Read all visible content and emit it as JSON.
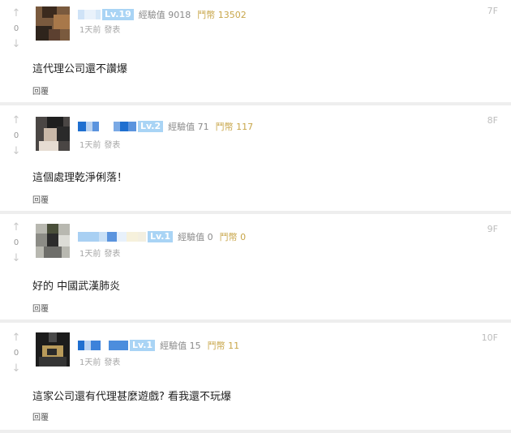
{
  "comments": [
    {
      "vote": {
        "up_icon": "up-arrow-icon",
        "count": "0",
        "down_icon": "down-arrow-icon"
      },
      "level": "Lv.19",
      "exp_label": "經驗值",
      "exp_value": "9018",
      "gold_label": "鬥幣",
      "gold_value": "13502",
      "time": "1天前",
      "post_action": "發表",
      "floor": "7F",
      "text": "這代理公司還不讚爆",
      "reply": "回覆"
    },
    {
      "vote": {
        "up_icon": "up-arrow-icon",
        "count": "0",
        "down_icon": "down-arrow-icon"
      },
      "level": "Lv.2",
      "exp_label": "經驗值",
      "exp_value": "71",
      "gold_label": "鬥幣",
      "gold_value": "117",
      "time": "1天前",
      "post_action": "發表",
      "floor": "8F",
      "text": "這個處理乾淨俐落！",
      "reply": "回覆"
    },
    {
      "vote": {
        "up_icon": "up-arrow-icon",
        "count": "0",
        "down_icon": "down-arrow-icon"
      },
      "level": "Lv.1",
      "exp_label": "經驗值",
      "exp_value": "0",
      "gold_label": "鬥幣",
      "gold_value": "0",
      "time": "1天前",
      "post_action": "發表",
      "floor": "9F",
      "text": "好的 中國武漢肺炎",
      "reply": "回覆"
    },
    {
      "vote": {
        "up_icon": "up-arrow-icon",
        "count": "0",
        "down_icon": "down-arrow-icon"
      },
      "level": "Lv.1",
      "exp_label": "經驗值",
      "exp_value": "15",
      "gold_label": "鬥幣",
      "gold_value": "11",
      "time": "1天前",
      "post_action": "發表",
      "floor": "10F",
      "text": "這家公司還有代理甚麼遊戲? 看我還不玩爆",
      "reply": "回覆"
    }
  ]
}
